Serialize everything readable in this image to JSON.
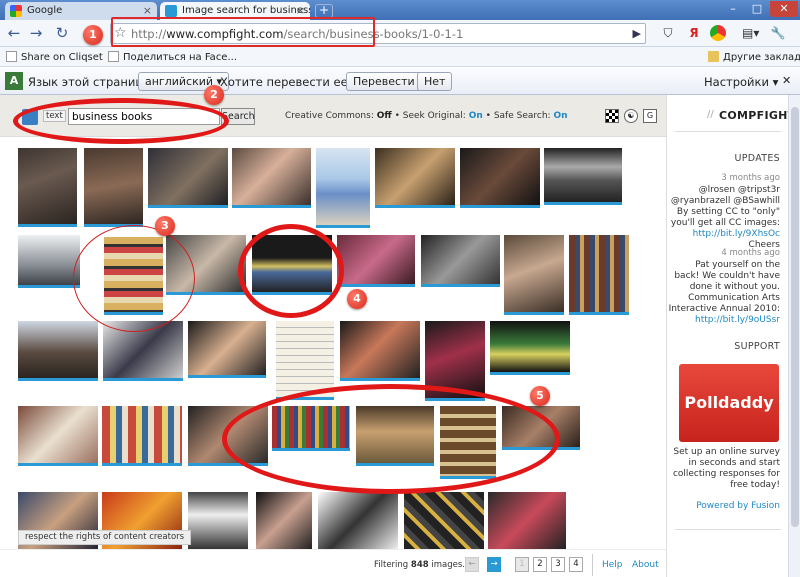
{
  "browser": {
    "tabs": [
      {
        "title": "Google",
        "active": false
      },
      {
        "title": "Image search for business ...",
        "active": true
      }
    ],
    "new_tab": "+",
    "window_controls": {
      "minimize": "–",
      "maximize": "□",
      "close": "✕"
    }
  },
  "toolbar": {
    "back": "←",
    "forward": "→",
    "reload": "↻",
    "url_prefix": "http://",
    "url_host": "www.compfight.com",
    "url_path": "/search/business-books/1-0-1-1",
    "go": "▶",
    "extension_icons": [
      "yandex-ya",
      "chrome-icon",
      "page-menu",
      "wrench-menu"
    ]
  },
  "bookmarks": {
    "items": [
      {
        "label": "Share on Cliqset",
        "icon": "page-icon"
      },
      {
        "label": "Поделиться на Face...",
        "icon": "page-icon"
      }
    ],
    "other": "Другие закладки"
  },
  "translate_bar": {
    "prompt": "Язык этой страницы",
    "language": "английский ▾",
    "question": "Хотите перевести ее?",
    "translate_btn": "Перевести",
    "no_btn": "Нет",
    "settings": "Настройки ▾",
    "close": "✕"
  },
  "search": {
    "mode_label": "text",
    "query": "business books",
    "button": "Search",
    "cc_label": "Creative Commons:",
    "cc_value": "Off",
    "seek_label": "• Seek Original:",
    "seek_value": "On",
    "safe_label": "• Safe Search:",
    "safe_value": "On"
  },
  "sidebar": {
    "brand": "COMPFIGHT",
    "updates_heading": "UPDATES",
    "update1_time": "3 months ago",
    "update1_text": "@lrosen @tripst3r @ryanbrazell @BSawhill By setting CC to \"only\" you'll get all CC images:",
    "update1_link": "http://bit.ly/9XhsOc",
    "update1_tail": "Cheers",
    "update2_time": "4 months ago",
    "update2_text": "Pat yourself on the back! We couldn't have done it without you. Communication Arts Interactive Annual 2010:",
    "update2_link": "http://bit.ly/9oUSsr",
    "support_heading": "SUPPORT",
    "ad_logo": "Polldaddy",
    "ad_text": "Set up an online survey in seconds and start collecting responses for free today!",
    "ad_powered": "Powered by Fusion"
  },
  "footer": {
    "respect": "respect the rights of content creators",
    "filtering_prefix": "Filtering ",
    "filtering_count": "848",
    "filtering_suffix": " images.",
    "pages": [
      "1",
      "2",
      "3",
      "4"
    ],
    "help": "Help",
    "about": "About"
  },
  "annotations": {
    "badges": [
      "1",
      "2",
      "3",
      "4",
      "5"
    ]
  },
  "colors": {
    "accent": "#2a9ad6",
    "annotation_red": "#e01818",
    "tab_blue": "#4a7bc0"
  }
}
